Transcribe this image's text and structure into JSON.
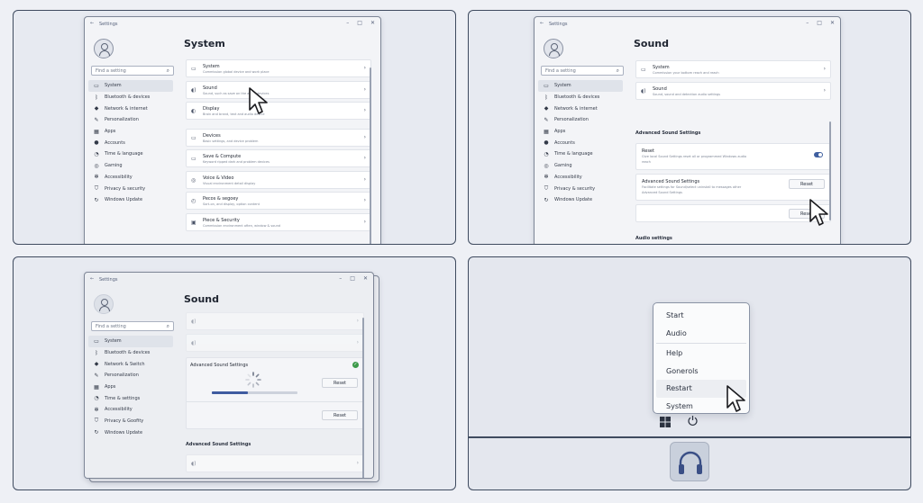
{
  "panel1": {
    "window_title": "Settings",
    "page_title": "System",
    "search_placeholder": "Find a setting",
    "nav": [
      {
        "label": "System",
        "icon": "▭",
        "active": true
      },
      {
        "label": "Bluetooth & devices",
        "icon": "ᛒ"
      },
      {
        "label": "Network & internet",
        "icon": "◆"
      },
      {
        "label": "Personalization",
        "icon": "✎"
      },
      {
        "label": "Apps",
        "icon": "▦"
      },
      {
        "label": "Accounts",
        "icon": "●"
      },
      {
        "label": "Time & language",
        "icon": "◔"
      },
      {
        "label": "Gaming",
        "icon": "◎"
      },
      {
        "label": "Accessibility",
        "icon": "✻"
      },
      {
        "label": "Privacy & security",
        "icon": "⛉"
      },
      {
        "label": "Windows Update",
        "icon": "↻"
      }
    ],
    "cards": [
      {
        "title": "System",
        "sub": "Commission global device and work place",
        "icon": "▭"
      },
      {
        "title": "Sound",
        "sub": "Sound, such as save on the audio devices",
        "icon": "◖)"
      },
      {
        "title": "Display",
        "sub": "Brain and brand, text and audio device",
        "icon": "◐"
      },
      {
        "title": "Devices",
        "sub": "Basic settings, and device problem",
        "icon": "▭"
      },
      {
        "title": "Save & Compute",
        "sub": "Keyword ripped dark and problem devices",
        "icon": "▭"
      },
      {
        "title": "Voice & Video",
        "sub": "Visual environment detail display",
        "icon": "◎"
      },
      {
        "title": "Pecos & segoey",
        "sub": "Sort-on, and display, option content",
        "icon": "◴"
      },
      {
        "title": "Piece & Security",
        "sub": "Commission environment often, window & sound",
        "icon": "▣"
      }
    ]
  },
  "panel2": {
    "window_title": "Settings",
    "page_title": "Sound",
    "search_placeholder": "Find a setting",
    "nav": [
      {
        "label": "System",
        "icon": "▭",
        "active": true
      },
      {
        "label": "Bluetooth & devices",
        "icon": "ᛒ"
      },
      {
        "label": "Network & internet",
        "icon": "◆"
      },
      {
        "label": "Personalization",
        "icon": "✎"
      },
      {
        "label": "Apps",
        "icon": "▦"
      },
      {
        "label": "Accounts",
        "icon": "●"
      },
      {
        "label": "Time & language",
        "icon": "◔"
      },
      {
        "label": "Gaming",
        "icon": "◎"
      },
      {
        "label": "Accessibility",
        "icon": "✻"
      },
      {
        "label": "Privacy & security",
        "icon": "⛉"
      },
      {
        "label": "Windows Update",
        "icon": "↻"
      }
    ],
    "cards": [
      {
        "title": "System",
        "sub": "Commission your bottom reach and reach",
        "icon": "▭"
      },
      {
        "title": "Sound",
        "sub": "Sound, sound and detection audio settings",
        "icon": "◖)"
      }
    ],
    "section_title": "Advanced Sound Settings",
    "reset_card_title": "Reset",
    "reset_card_sub": "Give local Sound Settings reset all or programmed Windows audio",
    "reset_card_sub2": "reach",
    "adv_card_title": "Advanced Sound Settings",
    "adv_card_sub": "Facilitate settings for Sound/select uninstall to messages other",
    "adv_card_sub2": "Advanced Sound Settings",
    "reset_label": "Reset",
    "reset_label2": "Reset",
    "audio_section_title": "Audio settings"
  },
  "panel3": {
    "window_title": "Settings",
    "page_title": "Sound",
    "search_placeholder": "Find a setting",
    "nav": [
      {
        "label": "System",
        "icon": "▭",
        "active": true
      },
      {
        "label": "Bluetooth & devices",
        "icon": "ᛒ"
      },
      {
        "label": "Network & Switch",
        "icon": "◆"
      },
      {
        "label": "Personalization",
        "icon": "✎"
      },
      {
        "label": "Apps",
        "icon": "▦"
      },
      {
        "label": "Time & settings",
        "icon": "◔"
      },
      {
        "label": "Accessibility",
        "icon": "✻"
      },
      {
        "label": "Privacy & Goofity",
        "icon": "⛉"
      },
      {
        "label": "Windows Update",
        "icon": "↻"
      }
    ],
    "section_title": "Advanced Sound Settings",
    "reset_label": "Reset",
    "reset_label2": "Reset",
    "section2_title": "Advanced Sound Settings",
    "progress": 0.42
  },
  "panel4": {
    "menu": [
      "Start",
      "Audio",
      "Help",
      "Gonerols",
      "Restart",
      "System"
    ],
    "highlighted": "Restart"
  }
}
